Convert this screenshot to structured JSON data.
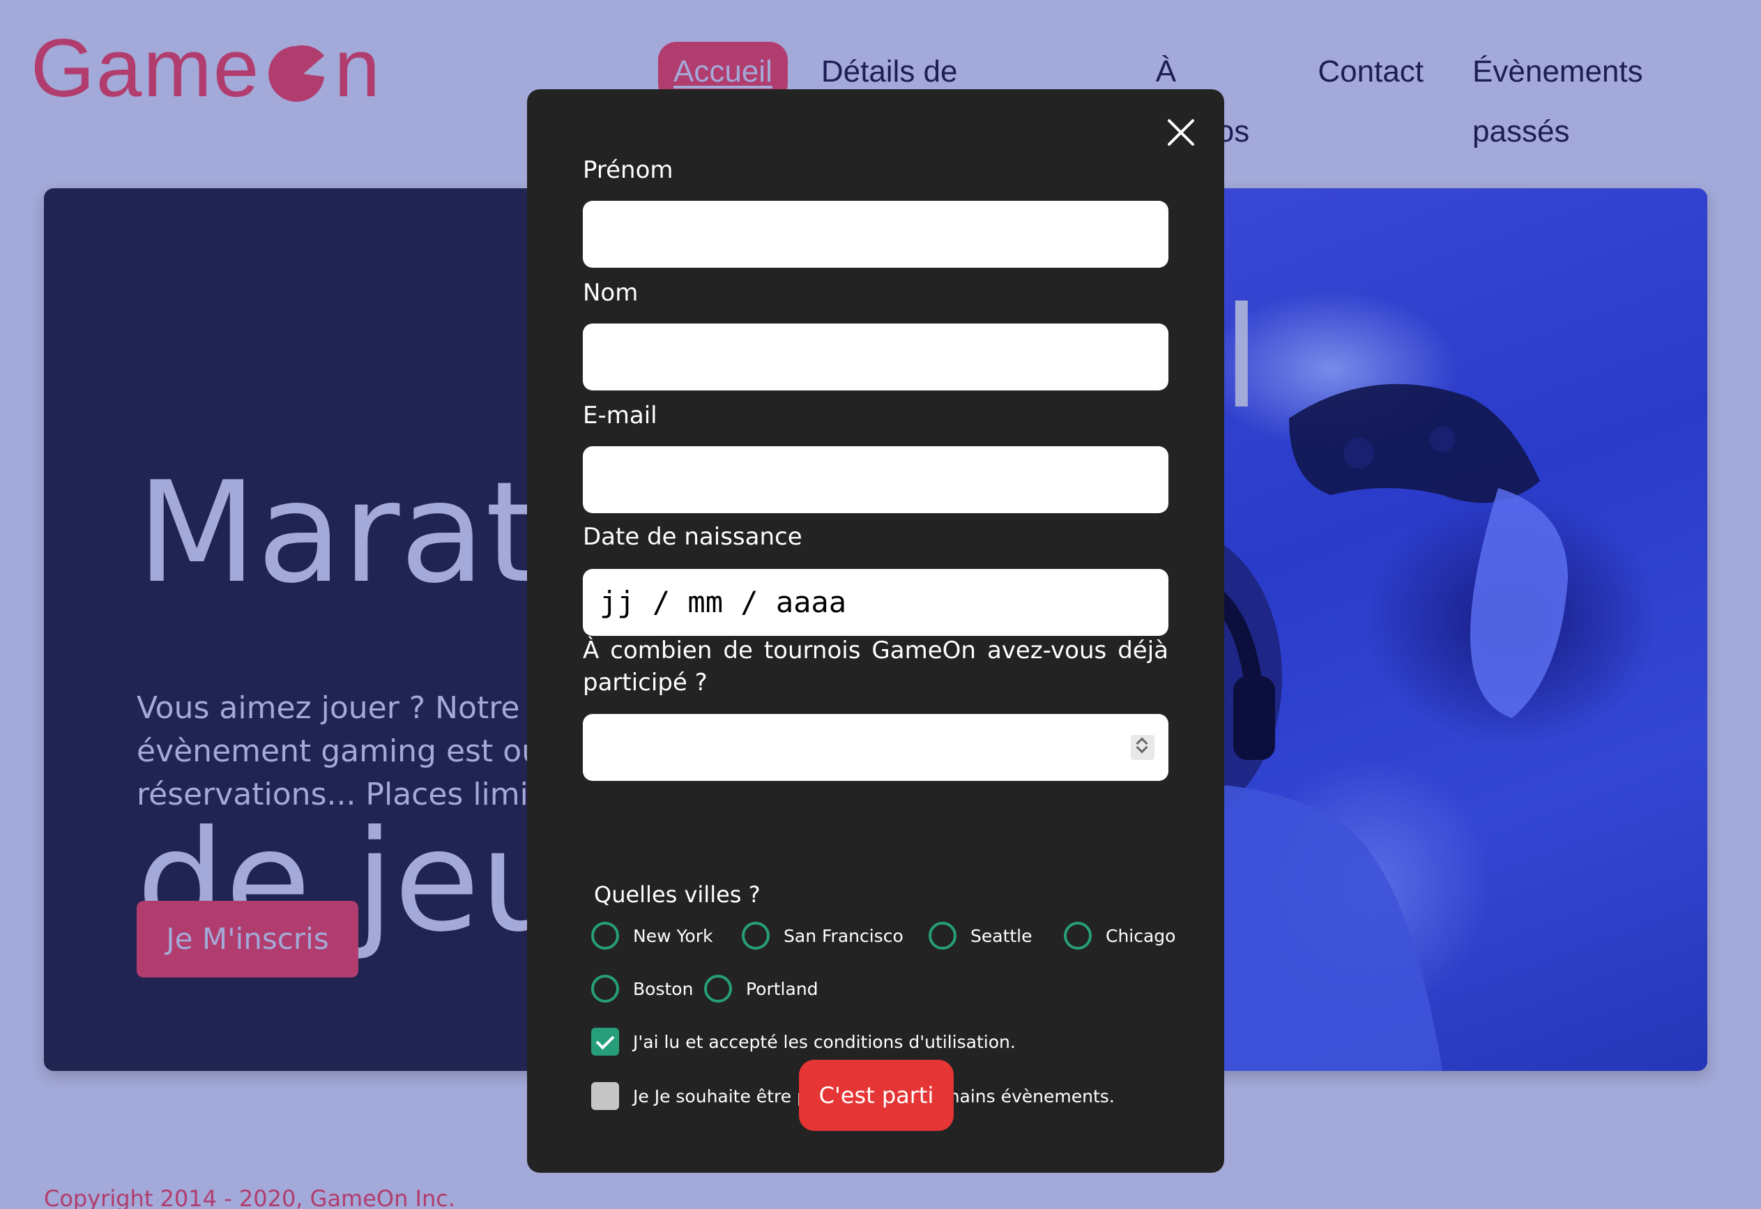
{
  "header": {
    "logo_left": "Game",
    "logo_right": "n",
    "nav": [
      {
        "label": "Accueil",
        "active": true
      },
      {
        "label": "Détails de l'évènement"
      },
      {
        "label": "À propos"
      },
      {
        "label": "Contact"
      },
      {
        "label": "Évènements passés"
      }
    ]
  },
  "hero": {
    "title_line1": "Marath",
    "title_line2": "de jeux",
    "title_right_fragment": "l",
    "subtitle_line1": "Vous aimez jouer ? Notre p",
    "subtitle_line2": "évènement gaming est ou",
    "subtitle_line3": "réservations... Places limité",
    "cta_label": "Je M'inscris"
  },
  "footer": {
    "copyright": "Copyright 2014 - 2020, GameOn Inc."
  },
  "modal": {
    "fields": {
      "first_name_label": "Prénom",
      "last_name_label": "Nom",
      "email_label": "E-mail",
      "birthdate_label": "Date de naissance",
      "birthdate_placeholder": "jj / mm / aaaa",
      "tournaments_question": "À combien de tournois GameOn avez-vous déjà participé ?"
    },
    "cities_title": "Quelles villes ?",
    "cities": [
      "New York",
      "San Francisco",
      "Seattle",
      "Chicago",
      "Boston",
      "Portland"
    ],
    "checkbox_terms": "J'ai lu et accepté les conditions d'utilisation.",
    "checkbox_terms_checked": true,
    "checkbox_newsletter": "Je Je souhaite être prévenu des prochains évènements.",
    "checkbox_newsletter_checked": false,
    "submit_label": "C'est parti"
  },
  "colors": {
    "page_bg": "#a3a9d8",
    "brand": "#b13d6e",
    "hero_bg": "#212351",
    "modal_bg": "#232323",
    "radio_accent": "#279e7a",
    "submit": "#e53534"
  }
}
